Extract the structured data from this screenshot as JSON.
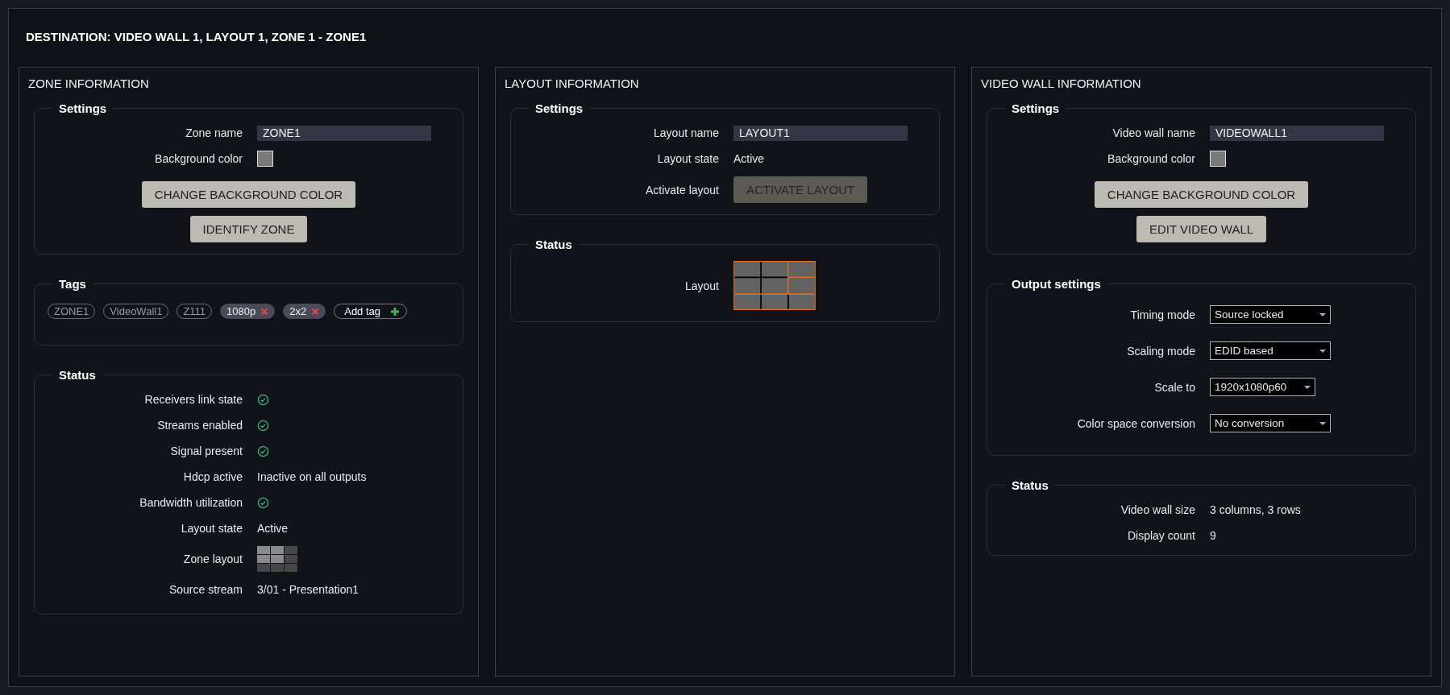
{
  "title": "DESTINATION: VIDEO WALL 1, LAYOUT 1, ZONE 1 - ZONE1",
  "panels": [
    {
      "heading": "ZONE INFORMATION",
      "groups": [
        {
          "legend": "Settings",
          "rows": [
            {
              "kind": "input",
              "label": "Zone name",
              "value": "ZONE1"
            },
            {
              "kind": "color",
              "label": "Background color"
            }
          ],
          "buttons": [
            {
              "label": "CHANGE BACKGROUND COLOR",
              "disabled": false
            },
            {
              "label": "IDENTIFY ZONE",
              "disabled": false
            }
          ]
        },
        {
          "legend": "Tags",
          "tags": [
            {
              "label": "ZONE1",
              "removable": false
            },
            {
              "label": "VideoWall1",
              "removable": false
            },
            {
              "label": "Z111",
              "removable": false
            },
            {
              "label": "1080p",
              "removable": true
            },
            {
              "label": "2x2",
              "removable": true
            }
          ],
          "add_tag": "Add tag"
        },
        {
          "legend": "Status",
          "tall": true,
          "rows": [
            {
              "kind": "check",
              "label": "Receivers link state",
              "ok": true
            },
            {
              "kind": "check",
              "label": "Streams enabled",
              "ok": true
            },
            {
              "kind": "check",
              "label": "Signal present",
              "ok": true
            },
            {
              "kind": "text",
              "label": "Hdcp active",
              "value": "Inactive on all outputs"
            },
            {
              "kind": "check",
              "label": "Bandwidth utilization",
              "ok": true
            },
            {
              "kind": "text",
              "label": "Layout state",
              "value": "Active"
            },
            {
              "kind": "zone",
              "label": "Zone layout",
              "cells": [
                {
                  "selected": true
                },
                {
                  "selected": true
                },
                {
                  "selected": false
                },
                {
                  "selected": true
                },
                {
                  "selected": true
                },
                {
                  "selected": false
                },
                {
                  "selected": false
                },
                {
                  "selected": false
                },
                {
                  "selected": false
                }
              ]
            },
            {
              "kind": "text",
              "label": "Source stream",
              "value": "3/01 - Presentation1"
            }
          ]
        }
      ]
    },
    {
      "heading": "LAYOUT INFORMATION",
      "groups": [
        {
          "legend": "Settings",
          "rows": [
            {
              "kind": "input",
              "label": "Layout name",
              "value": "LAYOUT1"
            },
            {
              "kind": "text",
              "label": "Layout state",
              "value": "Active"
            },
            {
              "kind": "button",
              "label": "Activate layout",
              "button": "ACTIVATE LAYOUT",
              "disabled": true
            }
          ]
        },
        {
          "legend": "Status",
          "rows": [
            {
              "kind": "layout",
              "label": "Layout"
            }
          ]
        }
      ]
    },
    {
      "heading": "VIDEO WALL INFORMATION",
      "groups": [
        {
          "legend": "Settings",
          "rows": [
            {
              "kind": "input",
              "label": "Video wall name",
              "value": "VIDEOWALL1"
            },
            {
              "kind": "color",
              "label": "Background color"
            }
          ],
          "buttons": [
            {
              "label": "CHANGE BACKGROUND COLOR",
              "disabled": false
            },
            {
              "label": "EDIT VIDEO WALL",
              "disabled": false
            }
          ]
        },
        {
          "legend": "Output settings",
          "rows": [
            {
              "kind": "select",
              "label": "Timing mode",
              "value": "Source locked"
            },
            {
              "kind": "select",
              "label": "Scaling mode",
              "value": "EDID based"
            },
            {
              "kind": "select",
              "label": "Scale to",
              "value": "1920x1080p60",
              "narrow": true
            },
            {
              "kind": "select",
              "label": "Color space conversion",
              "value": "No conversion"
            }
          ]
        },
        {
          "legend": "Status",
          "rows": [
            {
              "kind": "text",
              "label": "Video wall size",
              "value": "3 columns, 3 rows"
            },
            {
              "kind": "text",
              "label": "Display count",
              "value": "9"
            }
          ]
        }
      ]
    }
  ]
}
